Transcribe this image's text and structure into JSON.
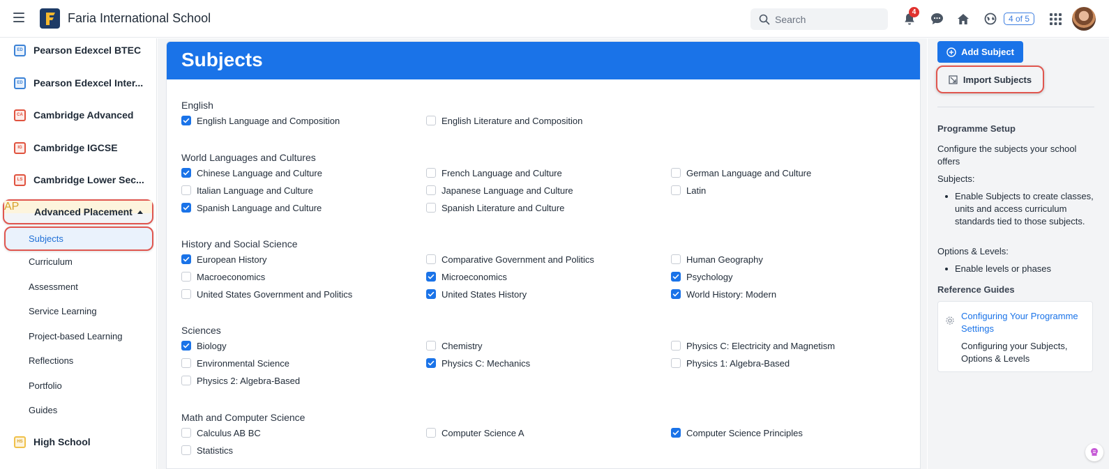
{
  "header": {
    "school_name": "Faria International School",
    "search_placeholder": "Search",
    "notification_count": "4",
    "pager": "4 of 5",
    "icons": [
      "menu-icon",
      "bell-icon",
      "chat-icon",
      "home-icon",
      "globe-icon",
      "apps-grid-icon"
    ]
  },
  "sidebar": {
    "programmes": [
      {
        "label": "Pearson Edexcel BTEC",
        "icon_color": "blue",
        "icon_text": "ED"
      },
      {
        "label": "Pearson Edexcel Inter...",
        "icon_color": "blue",
        "icon_text": "ED"
      },
      {
        "label": "Cambridge Advanced",
        "icon_color": "red",
        "icon_text": "CA"
      },
      {
        "label": "Cambridge IGCSE",
        "icon_color": "red",
        "icon_text": "IG"
      },
      {
        "label": "Cambridge Lower Sec...",
        "icon_color": "red",
        "icon_text": "LS"
      }
    ],
    "active_programme": {
      "label": "Advanced Placement",
      "icon_text": "AP"
    },
    "sub_items": [
      "Subjects",
      "Curriculum",
      "Assessment",
      "Service Learning",
      "Project-based Learning",
      "Reflections",
      "Portfolio",
      "Guides"
    ],
    "bottom_programme": {
      "label": "High School",
      "icon_text": "HS"
    }
  },
  "main": {
    "title": "Subjects",
    "groups": [
      {
        "title": "English",
        "items": [
          {
            "label": "English Language and Composition",
            "checked": true
          },
          {
            "label": "English Literature and Composition",
            "checked": false
          }
        ]
      },
      {
        "title": "World Languages and Cultures",
        "items": [
          {
            "label": "Chinese Language and Culture",
            "checked": true
          },
          {
            "label": "French Language and Culture",
            "checked": false
          },
          {
            "label": "German Language and Culture",
            "checked": false
          },
          {
            "label": "Italian Language and Culture",
            "checked": false
          },
          {
            "label": "Japanese Language and Culture",
            "checked": false
          },
          {
            "label": "Latin",
            "checked": false
          },
          {
            "label": "Spanish Language and Culture",
            "checked": true
          },
          {
            "label": "Spanish Literature and Culture",
            "checked": false
          }
        ]
      },
      {
        "title": "History and Social Science",
        "items": [
          {
            "label": "European History",
            "checked": true
          },
          {
            "label": "Comparative Government and Politics",
            "checked": false
          },
          {
            "label": "Human Geography",
            "checked": false
          },
          {
            "label": "Macroeconomics",
            "checked": false
          },
          {
            "label": "Microeconomics",
            "checked": true
          },
          {
            "label": "Psychology",
            "checked": true
          },
          {
            "label": "United States Government and Politics",
            "checked": false
          },
          {
            "label": "United States History",
            "checked": true
          },
          {
            "label": "World History: Modern",
            "checked": true
          }
        ]
      },
      {
        "title": "Sciences",
        "items": [
          {
            "label": "Biology",
            "checked": true
          },
          {
            "label": "Chemistry",
            "checked": false
          },
          {
            "label": "Physics C: Electricity and Magnetism",
            "checked": false
          },
          {
            "label": "Environmental Science",
            "checked": false
          },
          {
            "label": "Physics C: Mechanics",
            "checked": true
          },
          {
            "label": "Physics 1: Algebra-Based",
            "checked": false
          },
          {
            "label": "Physics 2: Algebra-Based",
            "checked": false
          }
        ]
      },
      {
        "title": "Math and Computer Science",
        "items": [
          {
            "label": "Calculus AB BC",
            "checked": false
          },
          {
            "label": "Computer Science A",
            "checked": false
          },
          {
            "label": "Computer Science Principles",
            "checked": true
          },
          {
            "label": "Statistics",
            "checked": false
          }
        ]
      }
    ]
  },
  "right": {
    "add_button": "Add Subject",
    "import_button": "Import Subjects",
    "setup_heading": "Programme Setup",
    "setup_text": "Configure the subjects your school offers",
    "subjects_label": "Subjects:",
    "subjects_bullet": "Enable Subjects to create classes, units and access curriculum standards tied to those subjects.",
    "options_label": "Options & Levels:",
    "options_bullet": "Enable levels or phases",
    "ref_heading": "Reference Guides",
    "guide_link": "Configuring Your Programme Settings",
    "guide_desc": "Configuring your Subjects, Options & Levels"
  },
  "colors": {
    "accent": "#1a73e8",
    "highlight": "#e0564f",
    "badge": "#e0322f"
  }
}
